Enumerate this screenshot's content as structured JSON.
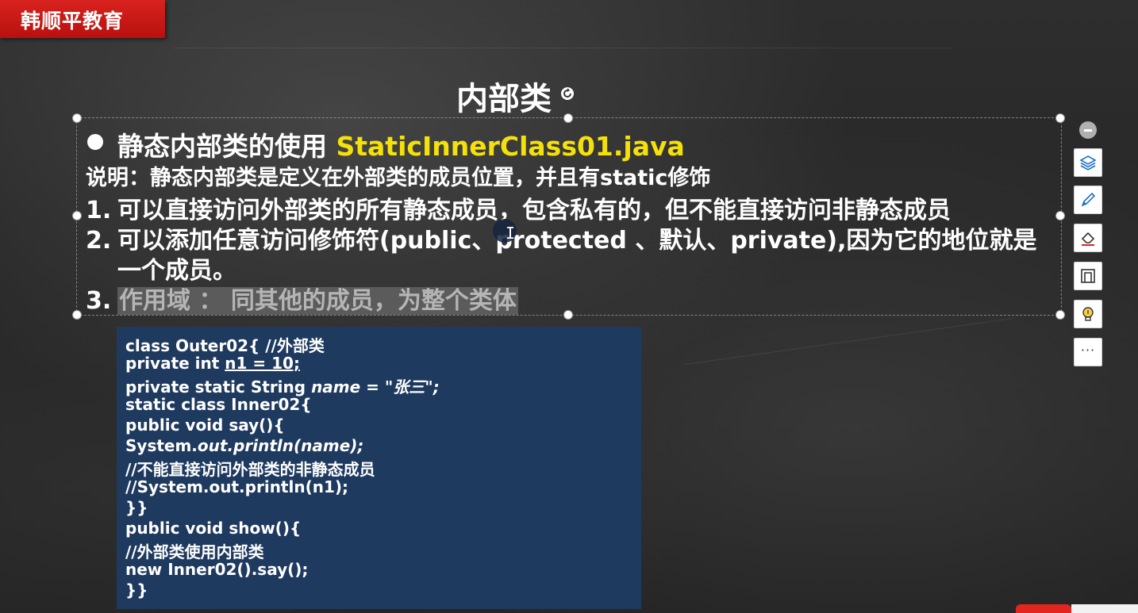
{
  "brand": {
    "label": "韩顺平教育"
  },
  "slide": {
    "title": "内部类",
    "heading_prefix": "静态内部类的使用 ",
    "heading_file": "StaticInnerClass01.java",
    "description": "说明：静态内部类是定义在外部类的成员位置，并且有static修饰",
    "items": [
      {
        "num": "1.",
        "text": "可以直接访问外部类的所有静态成员，包含私有的，但不能直接访问非静态成员"
      },
      {
        "num": "2.",
        "text": "可以添加任意访问修饰符(public、protected 、默认、private),因为它的地位就是",
        "continuation": "一个成员。"
      },
      {
        "num": "3.",
        "text": "作用域 ： 同其他的成员，为整个类体"
      }
    ]
  },
  "code": {
    "l1": "class Outer02{ //外部类",
    "l2_a": "private int ",
    "l2_b": "n1 = 10;",
    "l3_a": "private static String ",
    "l3_b": "name = \"张三\";",
    "l4": "static class Inner02{",
    "l5": "public void say(){",
    "l6_a": "System.",
    "l6_b": "out.println(name);",
    "l7": "//不能直接访问外部类的非静态成员",
    "l8": "//System.out.println(n1);",
    "l9": "}}",
    "l10": "public void show(){",
    "l11": "//外部类使用内部类",
    "l12": "new Inner02().say();",
    "l13": "}}"
  },
  "cursor": {
    "glyph": "I"
  },
  "toolbar": {
    "more_label": "···",
    "icons": [
      "collapse-icon",
      "layers-icon",
      "pen-icon",
      "eraser-icon",
      "frame-icon",
      "lightbulb-icon",
      "more-icon"
    ]
  },
  "colors": {
    "brand_red": "#d8221e",
    "file_yellow": "#f5e10a",
    "code_bg": "#1f3a5f",
    "highlight_gray": "#5b5b5b"
  }
}
